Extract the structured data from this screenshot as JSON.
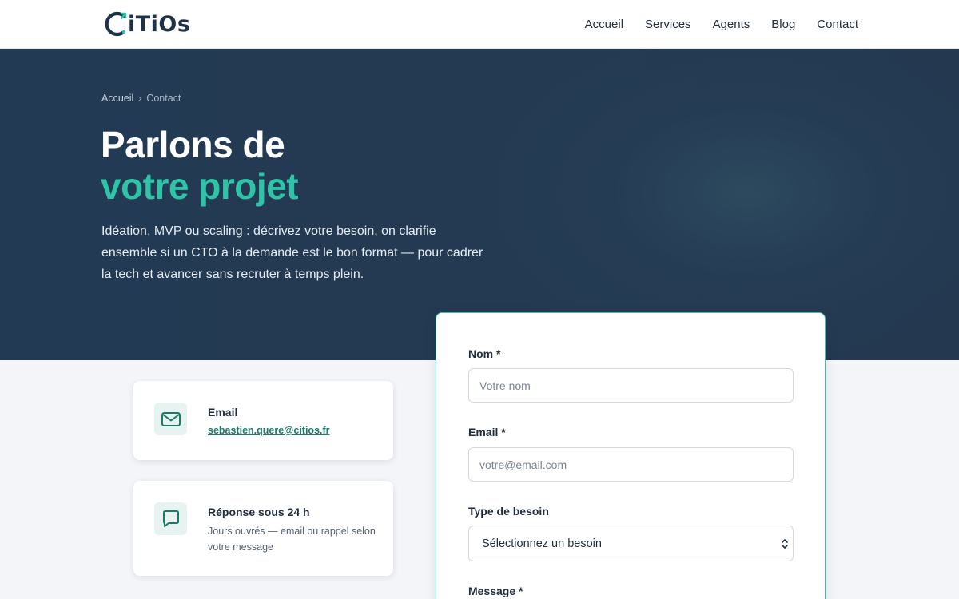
{
  "brand": {
    "logo_text": "iTiOs"
  },
  "nav": {
    "items": [
      "Accueil",
      "Services",
      "Agents",
      "Blog",
      "Contact"
    ]
  },
  "breadcrumb": {
    "home": "Accueil",
    "separator": "›",
    "current": "Contact"
  },
  "hero": {
    "title_line1": "Parlons de",
    "title_line2": "votre projet",
    "lead": "Idéation, MVP ou scaling : décrivez votre besoin, on clarifie ensemble si un CTO à la demande est le bon format — pour cadrer la tech et avancer sans recruter à temps plein."
  },
  "contact_cards": [
    {
      "icon": "mail-icon",
      "title": "Email",
      "link": "sebastien.quere@citios.fr"
    },
    {
      "icon": "chat-icon",
      "title": "Réponse sous 24 h",
      "text": "Jours ouvrés — email ou rappel selon votre message"
    }
  ],
  "form": {
    "name_label": "Nom *",
    "name_placeholder": "Votre nom",
    "email_label": "Email *",
    "email_placeholder": "votre@email.com",
    "need_label": "Type de besoin",
    "need_selected": "Sélectionnez un besoin",
    "message_label": "Message *"
  },
  "colors": {
    "accent": "#2fc4a8",
    "hero_bg": "#243a54",
    "link": "#1d7a6a",
    "form_border": "#3cc0aa"
  }
}
